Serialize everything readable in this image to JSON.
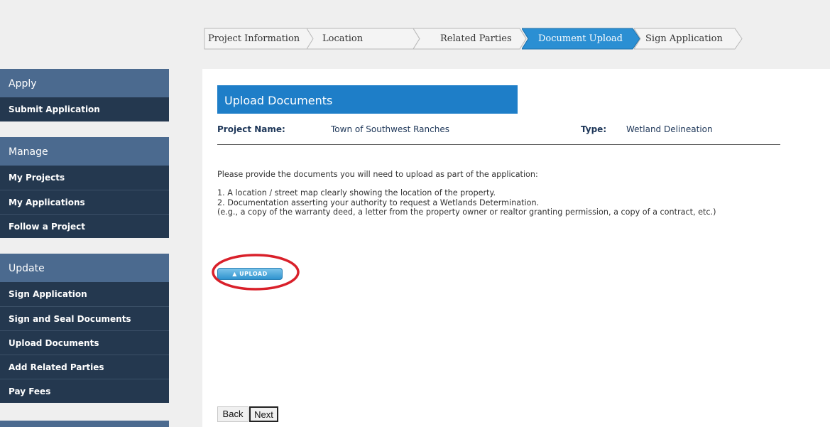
{
  "steps": [
    {
      "label": "Project Information",
      "state": "inactive"
    },
    {
      "label": "Location",
      "state": "inactive"
    },
    {
      "label": "Related Parties",
      "state": "inactive"
    },
    {
      "label": "Document Upload",
      "state": "active"
    },
    {
      "label": "Sign Application",
      "state": "inactive"
    }
  ],
  "sidebar": {
    "apply": {
      "heading": "Apply",
      "items": [
        "Submit Application"
      ]
    },
    "manage": {
      "heading": "Manage",
      "items": [
        "My Projects",
        "My Applications",
        "Follow a Project"
      ]
    },
    "update": {
      "heading": "Update",
      "items": [
        "Sign Application",
        "Sign and Seal Documents",
        "Upload Documents",
        "Add Related Parties",
        "Pay Fees"
      ]
    }
  },
  "main": {
    "title": "Upload Documents",
    "project_name_label": "Project Name:",
    "project_name_value": "Town of Southwest Ranches",
    "type_label": "Type:",
    "type_value": "Wetland Delineation",
    "intro": "Please provide the documents you will need to upload as part of the application:",
    "items": [
      "1. A location / street map clearly showing the location of the property.",
      "2. Documentation asserting your authority to request a Wetlands Determination.",
      "(e.g., a copy of the warranty deed, a letter from the property owner or realtor granting permission, a copy of a contract, etc.)"
    ],
    "upload_label": "UPLOAD",
    "back_label": "Back",
    "next_label": "Next"
  },
  "colors": {
    "nav_heading": "#4b6a8f",
    "nav_item": "#24384f",
    "title_bar": "#1e7ec8",
    "active_step": "#2b8fd3",
    "highlight_ring": "#d9202a"
  }
}
